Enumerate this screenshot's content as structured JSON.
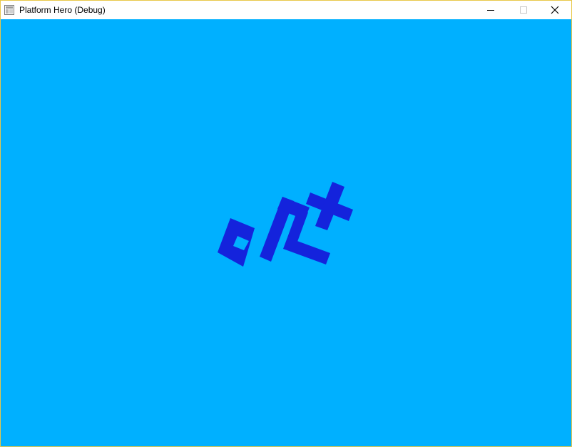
{
  "window": {
    "title": "Platform Hero (Debug)",
    "app_icon": "window-app-icon",
    "controls": {
      "minimize_icon": "minimize-icon",
      "maximize_icon": "maximize-icon",
      "close_icon": "close-icon"
    }
  },
  "scene": {
    "background_color": "#00b0ff",
    "shape_color": "#1423dc"
  }
}
